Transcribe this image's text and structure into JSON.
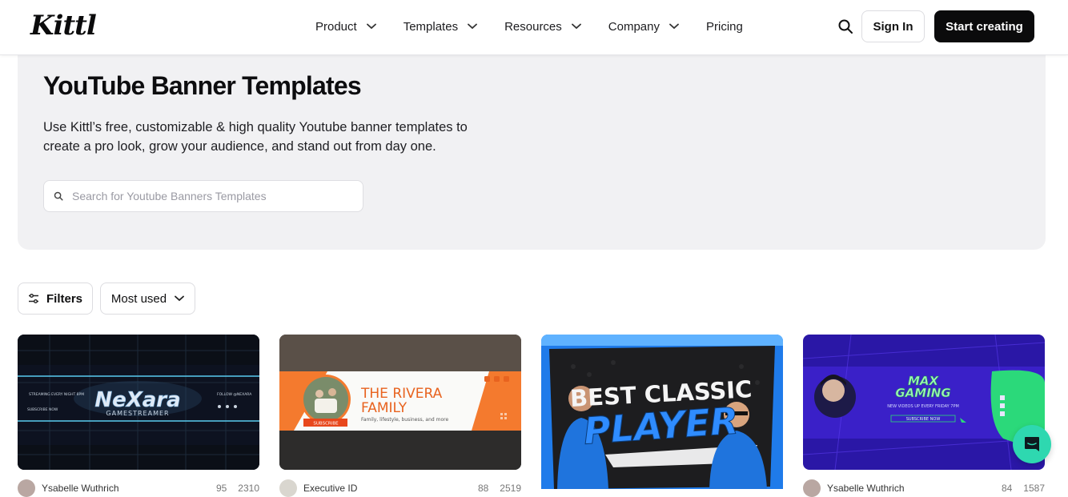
{
  "nav": {
    "logo": "Kittl",
    "items": [
      {
        "label": "Product",
        "has_dropdown": true
      },
      {
        "label": "Templates",
        "has_dropdown": true
      },
      {
        "label": "Resources",
        "has_dropdown": true
      },
      {
        "label": "Company",
        "has_dropdown": true
      },
      {
        "label": "Pricing",
        "has_dropdown": false
      }
    ],
    "search_icon": "search-icon",
    "sign_in": "Sign In",
    "cta": "Start creating"
  },
  "hero": {
    "title": "YouTube Banner Templates",
    "description": "Use Kittl’s free, customizable & high quality Youtube banner templates to create a pro look, grow your audience, and stand out from day one.",
    "search_placeholder": "Search for Youtube Banners Templates"
  },
  "toolbar": {
    "filters_label": "Filters",
    "sort_label": "Most used"
  },
  "cards": [
    {
      "thumb": {
        "title": "NeXara",
        "subtitle": "GAMESTREAMER",
        "left_text": "STREAMING EVERY NIGHT 8PM",
        "left_sub": "SUBSCRIBE NOW",
        "right_text": "FOLLOW @NEXARA"
      },
      "author": "Ysabelle Wuthrich",
      "likes": "95",
      "uses": "2310"
    },
    {
      "thumb": {
        "title_line1": "THE RIVERA",
        "title_line2": "FAMILY",
        "subtitle": "Family, lifestyle, business, and more",
        "button": "SUBSCRIBE"
      },
      "author": "Executive ID",
      "likes": "88",
      "uses": "2519"
    },
    {
      "thumb": {
        "title_line1": "BEST CLASSIC",
        "title_line2": "PLAYER"
      }
    },
    {
      "thumb": {
        "title_line1": "MAX",
        "title_line2": "GAMING",
        "subtitle": "NEW VIDEOS UP EVERY FRIDAY 7PM",
        "button": "SUBSCRIBE NOW"
      },
      "author": "Ysabelle Wuthrich",
      "likes": "84",
      "uses": "1587"
    }
  ],
  "colors": {
    "accent_dark": "#0b0b0c",
    "hero_bg": "#f1f1f3",
    "chat_bubble": "#2ed8b0",
    "rivera_orange": "#f47a2e",
    "player_blue": "#1f7bea",
    "max_green": "#2bd97a"
  },
  "chat_icon": "chat-bubble-icon"
}
